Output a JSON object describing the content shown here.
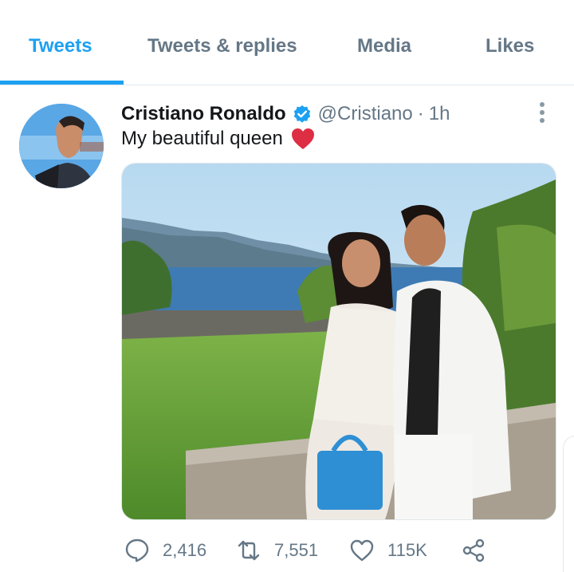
{
  "tabs": [
    {
      "label": "Tweets",
      "active": true
    },
    {
      "label": "Tweets & replies",
      "active": false
    },
    {
      "label": "Media",
      "active": false
    },
    {
      "label": "Likes",
      "active": false
    }
  ],
  "tweet": {
    "author_name": "Cristiano Ronaldo",
    "handle": "@Cristiano",
    "separator": "·",
    "time": "1h",
    "text": "My beautiful queen",
    "emoji": "red-heart",
    "verified": true
  },
  "actions": {
    "replies": "2,416",
    "retweets": "7,551",
    "likes": "115K"
  },
  "colors": {
    "accent": "#1da1f2",
    "secondary_text": "#657786",
    "border": "#e1e8ed"
  },
  "icons": [
    "verified-badge-icon",
    "more-options-icon",
    "reply-icon",
    "retweet-icon",
    "like-icon",
    "share-icon",
    "heart-emoji-icon"
  ]
}
